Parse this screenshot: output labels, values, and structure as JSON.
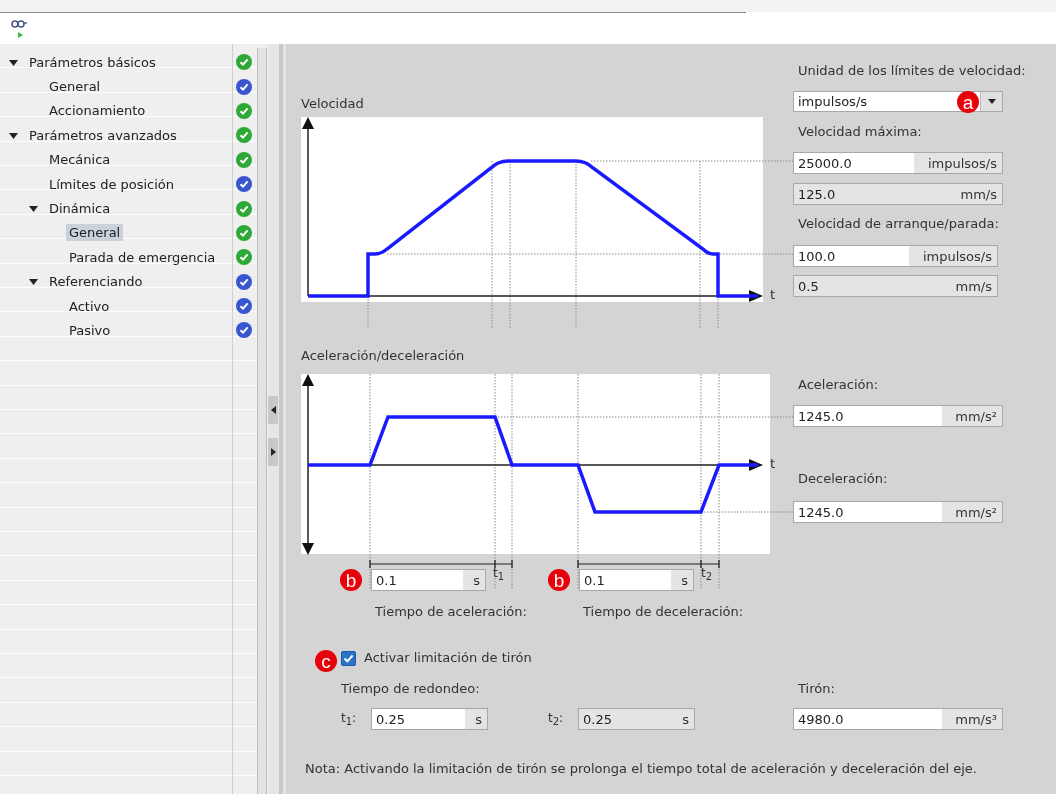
{
  "tree": {
    "items": [
      {
        "label": "Parámetros básicos",
        "color": "#2ea836",
        "expanded": true,
        "selected": false,
        "children": [
          {
            "label": "General",
            "color": "#3a55d0",
            "selected": false
          },
          {
            "label": "Accionamiento",
            "color": "#2ea836",
            "selected": false
          }
        ]
      },
      {
        "label": "Parámetros avanzados",
        "color": "#2ea836",
        "expanded": true,
        "selected": false,
        "children": [
          {
            "label": "Mecánica",
            "color": "#2ea836",
            "selected": false
          },
          {
            "label": "Límites de posición",
            "color": "#3a55d0",
            "selected": false
          },
          {
            "label": "Dinámica",
            "color": "#2ea836",
            "expanded": true,
            "selected": false,
            "children": [
              {
                "label": "General",
                "color": "#2ea836",
                "selected": true
              },
              {
                "label": "Parada de emergencia",
                "color": "#2ea836",
                "selected": false
              }
            ]
          },
          {
            "label": "Referenciando",
            "color": "#3a55d0",
            "expanded": true,
            "selected": false,
            "children": [
              {
                "label": "Activo",
                "color": "#3a55d0",
                "selected": false
              },
              {
                "label": "Pasivo",
                "color": "#3a55d0",
                "selected": false
              }
            ]
          }
        ]
      }
    ]
  },
  "panel": {
    "speed_unit": {
      "label": "Unidad de los límites de velocidad:",
      "value": "impulsos/s",
      "marker": "a"
    },
    "velocity_diagram": {
      "title": "Velocidad",
      "axis_label": "t"
    },
    "max_speed": {
      "label": "Velocidad máxima:",
      "fields": [
        {
          "value": "25000.0",
          "unit": "impulsos/s",
          "readonly": false
        },
        {
          "value": "125.0",
          "unit": "mm/s",
          "readonly": true
        }
      ]
    },
    "start_stop_speed": {
      "label": "Velocidad de arranque/parada:",
      "fields": [
        {
          "value": "100.0",
          "unit": "impulsos/s",
          "readonly": false
        },
        {
          "value": "0.5",
          "unit": "mm/s",
          "readonly": true
        }
      ]
    },
    "accel_diagram": {
      "title": "Aceleración/deceleración",
      "axis_label": "t",
      "interval_labels": [
        "t$_{1}$",
        "t$_{2}$"
      ]
    },
    "acceleration": {
      "label": "Aceleración:",
      "field": {
        "value": "1245.0",
        "unit": "mm/s²",
        "readonly": false
      }
    },
    "deceleration": {
      "label": "Deceleración:",
      "field": {
        "value": "1245.0",
        "unit": "mm/s²",
        "readonly": false
      }
    },
    "accel_time": {
      "label": "Tiempo de aceleración:",
      "marker": "b",
      "field": {
        "value": "0.1",
        "unit": "s",
        "readonly": false
      }
    },
    "decel_time": {
      "label": "Tiempo de deceleración:",
      "marker": "b",
      "field": {
        "value": "0.1",
        "unit": "s",
        "readonly": false
      }
    },
    "jerk_limit": {
      "label": "Activar limitación de tirón",
      "checked": true,
      "marker": "c"
    },
    "rounding_time": {
      "label": "Tiempo de redondeo:",
      "fields": [
        {
          "prefix": "t$_{1}$:",
          "value": "0.25",
          "unit": "s",
          "readonly": false
        },
        {
          "prefix": "t$_{2}$:",
          "value": "0.25",
          "unit": "s",
          "readonly": true
        }
      ]
    },
    "jerk": {
      "label": "Tirón:",
      "field": {
        "value": "4980.0",
        "unit": "mm/s³",
        "readonly": false
      }
    },
    "note": "Nota: Activando la limitación de tirón se prolonga el tiempo total de aceleración y deceleración del eje."
  }
}
